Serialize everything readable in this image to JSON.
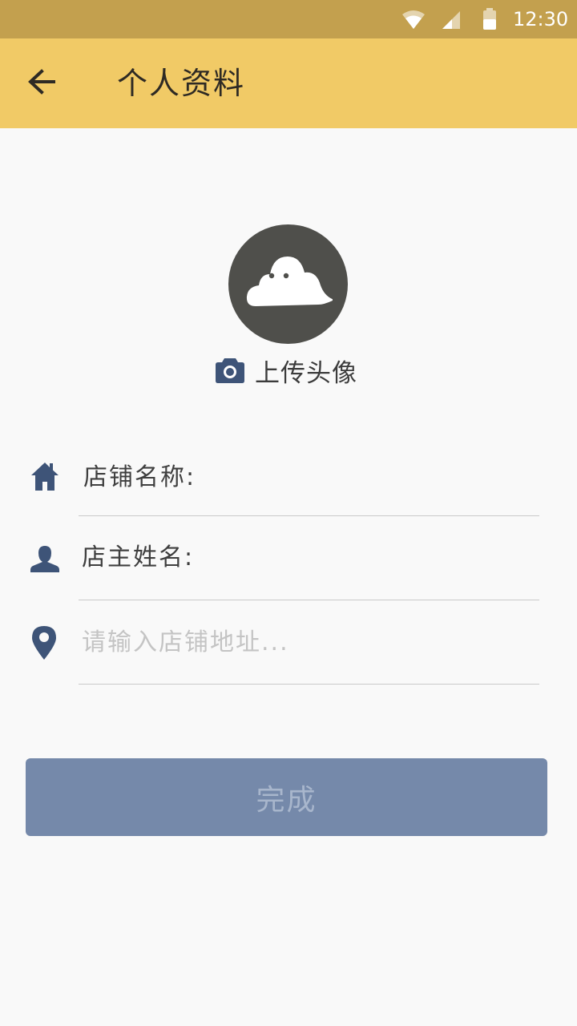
{
  "status_bar": {
    "time": "12:30",
    "icons": [
      "wifi-icon",
      "signal-icon",
      "battery-icon"
    ]
  },
  "app_bar": {
    "back_icon": "arrow-left-icon",
    "title": "个人资料",
    "background": "#f1ca66"
  },
  "profile": {
    "avatar_icon": "cloud-avatar-icon",
    "upload_icon": "camera-icon",
    "upload_label": "上传头像"
  },
  "form": {
    "shop_name": {
      "icon": "home-icon",
      "label": "店铺名称:"
    },
    "owner_name": {
      "icon": "person-icon",
      "label": "店主姓名:"
    },
    "address": {
      "icon": "location-pin-icon",
      "placeholder": "请输入店铺地址..."
    }
  },
  "actions": {
    "done_label": "完成",
    "button_color": "#7589aa"
  },
  "colors": {
    "status_bar": "#c3a04e",
    "icon_accent": "#3e5478"
  }
}
